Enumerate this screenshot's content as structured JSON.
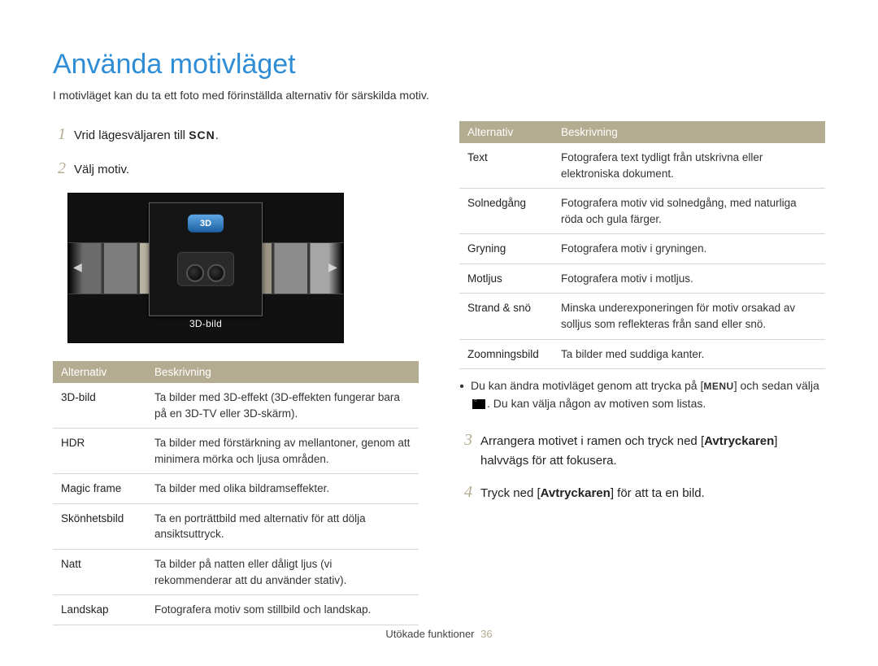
{
  "title": "Använda motivläget",
  "intro": "I motivläget kan du ta ett foto med förinställda alternativ för särskilda motiv.",
  "steps": {
    "s1_num": "1",
    "s1_pre": "Vrid lägesväljaren till ",
    "s1_mode": "SCN",
    "s1_post": ".",
    "s2_num": "2",
    "s2_text": "Välj motiv.",
    "s3_num": "3",
    "s3_pre": "Arrangera motivet i ramen och tryck ned [",
    "s3_bold": "Avtryckaren",
    "s3_post": "] halvvägs för att fokusera.",
    "s4_num": "4",
    "s4_pre": "Tryck ned [",
    "s4_bold": "Avtryckaren",
    "s4_post": "] för att ta en bild."
  },
  "screen": {
    "badge": "3D",
    "caption": "3D-bild"
  },
  "table_headers": {
    "col1": "Alternativ",
    "col2": "Beskrivning"
  },
  "table_left": [
    {
      "name": "3D-bild",
      "desc": "Ta bilder med 3D-effekt (3D-effekten fungerar bara på en 3D-TV eller 3D-skärm)."
    },
    {
      "name": "HDR",
      "desc": "Ta bilder med förstärkning av mellantoner, genom att minimera mörka och ljusa områden."
    },
    {
      "name": "Magic frame",
      "desc": "Ta bilder med olika bildramseffekter."
    },
    {
      "name": "Skönhetsbild",
      "desc": "Ta en porträttbild med alternativ för att dölja ansiktsuttryck."
    },
    {
      "name": "Natt",
      "desc": "Ta bilder på natten eller dåligt ljus (vi rekommenderar att du använder stativ)."
    },
    {
      "name": "Landskap",
      "desc": "Fotografera motiv som stillbild och landskap."
    }
  ],
  "table_right": [
    {
      "name": "Text",
      "desc": "Fotografera text tydligt från utskrivna eller elektroniska dokument."
    },
    {
      "name": "Solnedgång",
      "desc": "Fotografera motiv vid solnedgång, med naturliga röda och gula färger."
    },
    {
      "name": "Gryning",
      "desc": "Fotografera motiv i gryningen."
    },
    {
      "name": "Motljus",
      "desc": "Fotografera motiv i motljus."
    },
    {
      "name": "Strand & snö",
      "desc": "Minska underexponeringen för motiv orsakad av solljus som reflekteras från sand eller snö."
    },
    {
      "name": "Zoomningsbild",
      "desc": "Ta bilder med suddiga kanter."
    }
  ],
  "note": {
    "pre": "Du kan ändra motivläget genom att trycka på [",
    "menu": "MENU",
    "mid": "] och sedan välja ",
    "post": ". Du kan välja någon av motiven som listas."
  },
  "footer": {
    "section": "Utökade funktioner",
    "page": "36"
  }
}
